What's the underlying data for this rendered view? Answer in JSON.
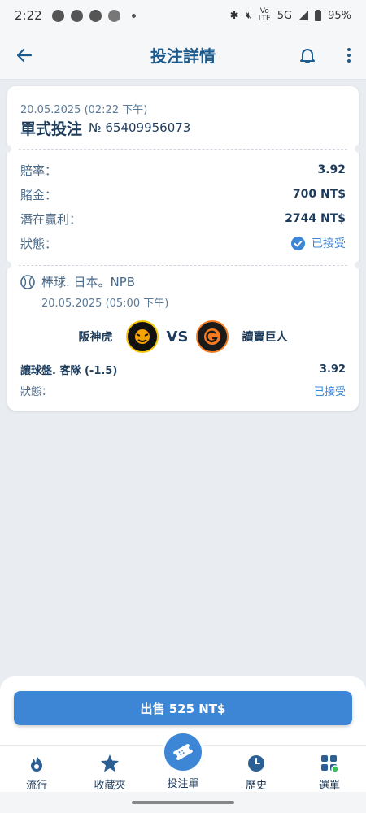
{
  "status_bar": {
    "time": "2:22",
    "battery": "95%",
    "network": "5G",
    "lte_top": "Vo",
    "lte_bottom": "LTE"
  },
  "header": {
    "title": "投注詳情"
  },
  "bet": {
    "date": "20.05.2025 (02:22 下午)",
    "type": "單式投注",
    "number": "№ 65409956073",
    "odds_label": "賠率：",
    "odds_value": "3.92",
    "stake_label": "賭金：",
    "stake_value": "700 NT$",
    "potential_label": "潛在贏利：",
    "potential_value": "2744 NT$",
    "status_label": "狀態：",
    "status_value": "已接受"
  },
  "event": {
    "league": "棒球. 日本。NPB",
    "datetime": "20.05.2025 (05:00 下午)",
    "home_team": "阪神虎",
    "away_team": "讀賣巨人",
    "vs": "VS",
    "market": "讓球盤. 客隊 (-1.5)",
    "market_odds": "3.92",
    "status_label": "狀態：",
    "status_value": "已接受"
  },
  "sell_button": "出售 525 NT$",
  "nav": [
    {
      "label": "流行",
      "icon": "fire-icon"
    },
    {
      "label": "收藏夾",
      "icon": "star-icon"
    },
    {
      "label": "投注單",
      "icon": "ticket-icon"
    },
    {
      "label": "歷史",
      "icon": "clock-icon"
    },
    {
      "label": "選單",
      "icon": "menu-grid-icon"
    }
  ],
  "colors": {
    "accent": "#3d86d6",
    "text_dark": "#1d3b5b",
    "background": "#e9ecf1"
  }
}
